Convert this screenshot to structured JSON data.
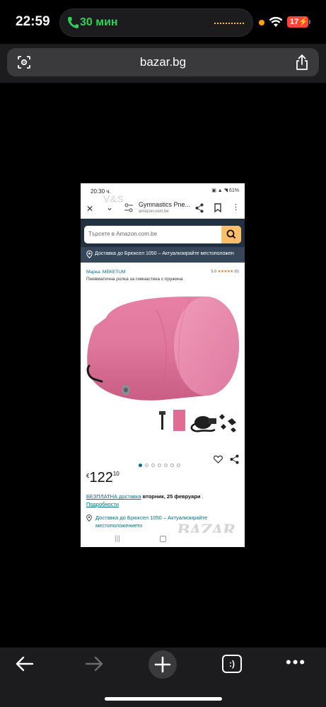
{
  "status_bar": {
    "time": "22:59",
    "call_label": "30 мин",
    "battery": "17"
  },
  "address_bar": {
    "url": "bazar.bg"
  },
  "screenshot": {
    "status_time": "20:30 ч.",
    "status_icons": "▣ ▲ ◥ 61%",
    "tab_title": "Gymnastics Pne...",
    "tab_domain": "amazon.com.be",
    "search_placeholder": "Търсете в Amazon.com.be",
    "location_bar": "Доставка до Брюксел 1050 – Актуализирайте местоположен",
    "brand": "Марка: MEKETUM",
    "rating_value": "5.0",
    "rating_stars": "★★★★★",
    "rating_count": "(6)",
    "product_title": "Пневматична ролка за гимнастика с пружина",
    "price_currency": "€",
    "price_whole": "122",
    "price_cents": "10",
    "delivery_link": "БЕЗПЛАТНА доставка",
    "delivery_date": " вторник, 25 февруари",
    "delivery_dot": " .",
    "details_link": "Подробности",
    "location_delivery": "Доставка до Брюксел 1050 – Актуализирайте местоположението",
    "watermark": "BAZAR",
    "watermark_top": "V&S",
    "gallery_pages": 7,
    "gallery_active": 1
  },
  "colors": {
    "accent_amazon": "#febd69",
    "amazon_header": "#22313f",
    "link": "#007185",
    "call_green": "#30d158",
    "battery_red": "#ff453a"
  },
  "icons": [
    "phone-icon",
    "wifi-icon",
    "lens-icon",
    "share-icon",
    "back-icon",
    "forward-icon",
    "plus-icon",
    "tabs-icon",
    "more-icon"
  ],
  "toolbar": {
    "tabs_label": ":)",
    "more_label": "•••"
  }
}
